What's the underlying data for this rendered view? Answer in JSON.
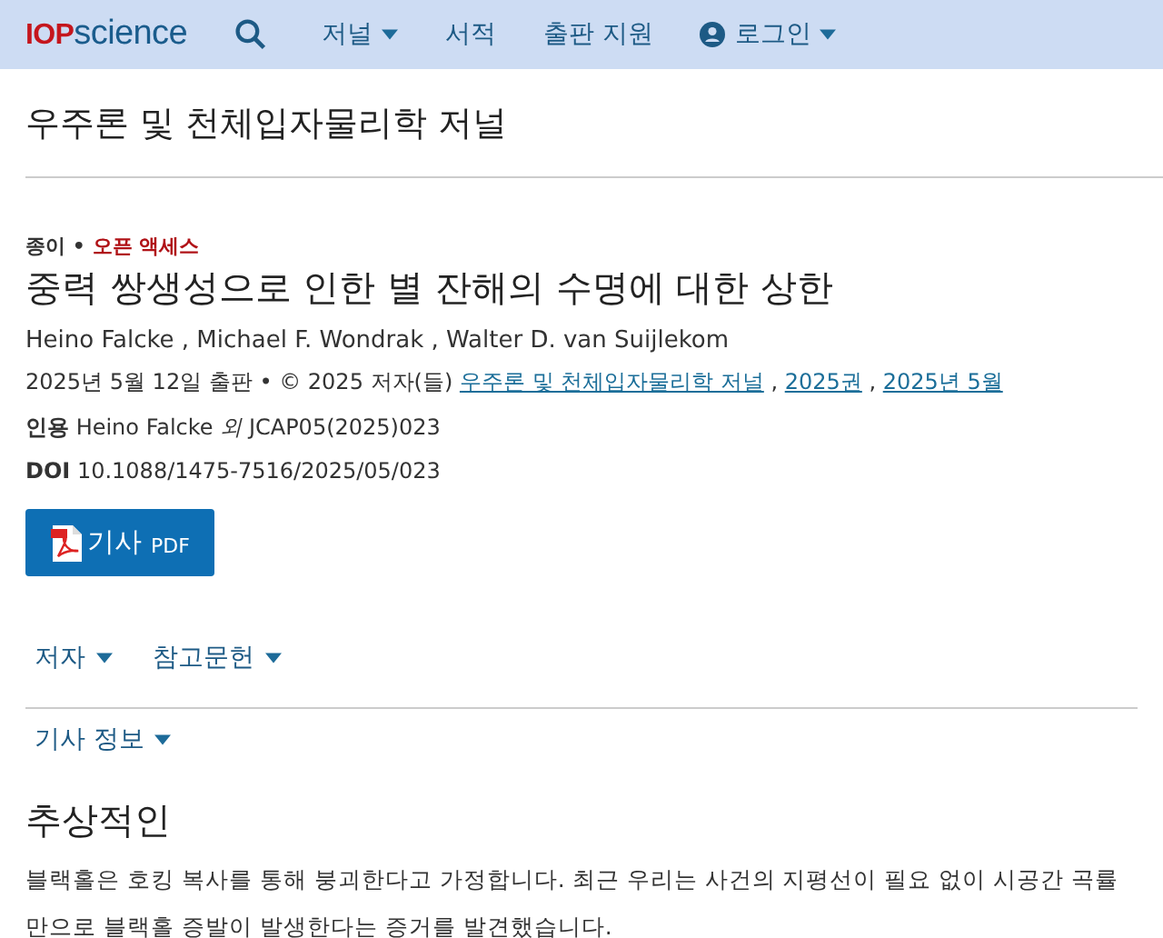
{
  "nav": {
    "logo": {
      "prefix": "IOP",
      "suffix": "science"
    },
    "items": [
      {
        "label": "저널",
        "dropdown": true,
        "kind": "menu"
      },
      {
        "label": "서적",
        "dropdown": false,
        "kind": "menu"
      },
      {
        "label": "출판 지원",
        "dropdown": false,
        "kind": "menu"
      },
      {
        "label": "로그인",
        "dropdown": true,
        "kind": "account"
      }
    ]
  },
  "journal_title": "우주론 및 천체입자물리학 저널",
  "article": {
    "type": "종이 •",
    "access": "오픈 액세스",
    "title": "중력 쌍생성으로 인한 별 잔해의 수명에 대한 상한",
    "authors": "Heino Falcke , Michael F. Wondrak , Walter D. van Suijlekom",
    "published": "2025년 5월 12일 출판 • © 2025 저자(들)",
    "links": [
      "우주론 및 천체입자물리학 저널",
      "2025권",
      "2025년 5월"
    ],
    "link_separator": " , ",
    "citation": "**인용** Heino Falcke *외* JCAP05(2025)023",
    "doi": "**DOI** 10.1088/1475-7516/2025/05/023",
    "pdf_button": {
      "label": "기사",
      "suffix": "PDF"
    }
  },
  "sections": [
    {
      "label": "저자",
      "expanded": false
    },
    {
      "label": "참고문헌",
      "expanded": false
    }
  ],
  "article_info": {
    "label": "기사 정보",
    "expanded": false
  },
  "abstract": {
    "heading": "추상적인",
    "text": "블랙홀은 호킹 복사를 통해 붕괴한다고 가정합니다. 최근 우리는 사건의 지평선이 필요 없이 시공간 곡률만으로 블랙홀 증발이 발생한다는 증거를 발견했습니다."
  }
}
